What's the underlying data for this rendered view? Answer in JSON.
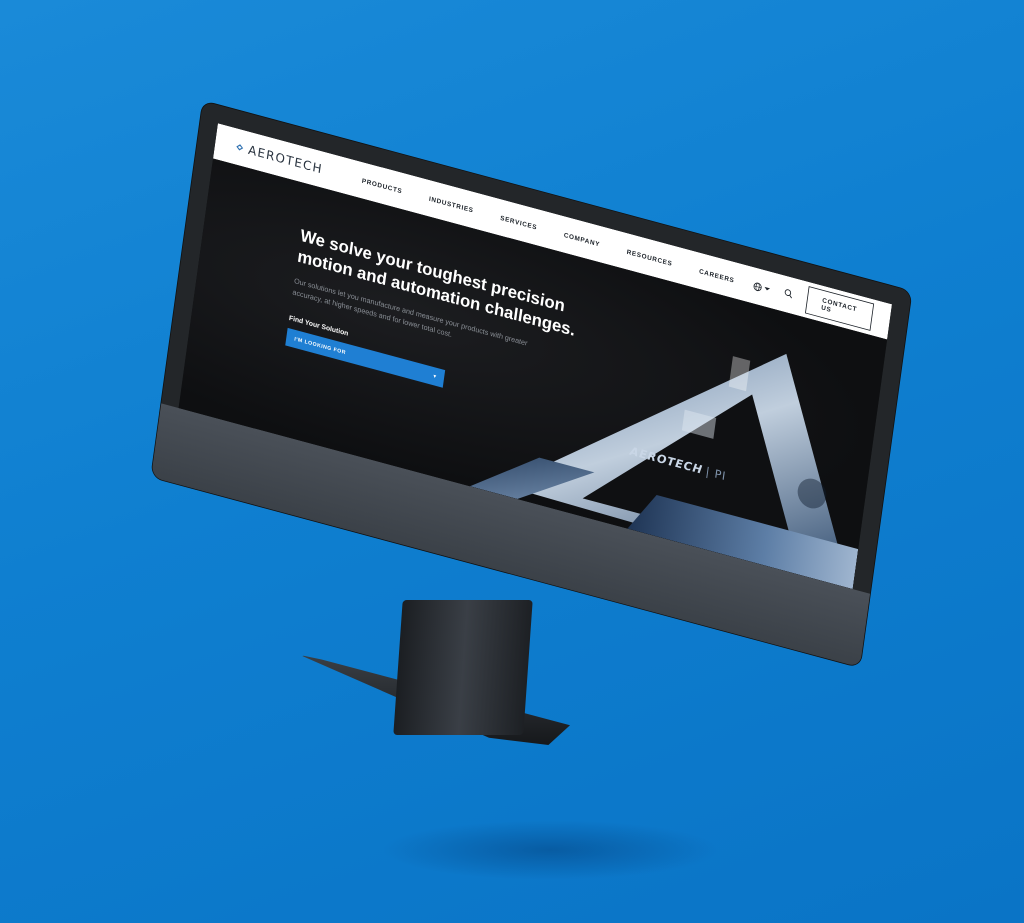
{
  "brand": {
    "name": "AEROTECH",
    "overlay_text": "AEROTECH",
    "overlay_suffix": "| PI"
  },
  "nav": {
    "items": [
      {
        "label": "PRODUCTS"
      },
      {
        "label": "INDUSTRIES"
      },
      {
        "label": "SERVICES"
      },
      {
        "label": "COMPANY"
      },
      {
        "label": "RESOURCES"
      }
    ],
    "careers": "CAREERS",
    "contact": "CONTACT US"
  },
  "hero": {
    "title": "We solve your toughest precision motion and automation challenges.",
    "subtitle": "Our solutions let you manufacture and measure your products with greater accuracy, at higher speeds and for lower total cost.",
    "find_label": "Find Your Solution",
    "dropdown_label": "I'M LOOKING FOR",
    "dropdown_arrow": "▾"
  },
  "colors": {
    "background": "#1185d6",
    "accent": "#1f7fd3",
    "screen": "#0f1012"
  },
  "icons": [
    "aerotech-logo-icon",
    "globe-icon",
    "search-icon",
    "chevron-down-icon"
  ]
}
